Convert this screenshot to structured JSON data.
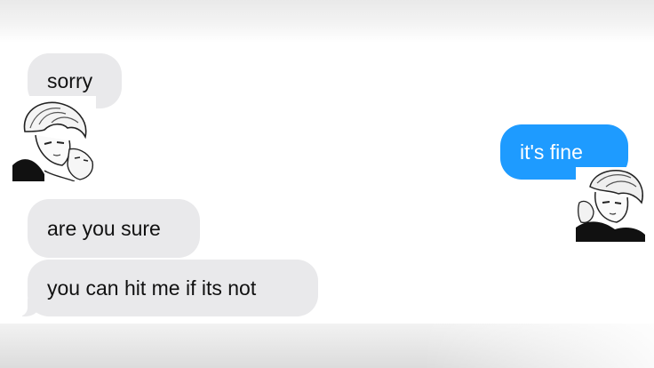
{
  "conversation": {
    "messages": [
      {
        "sender": "contact",
        "text": "sorry"
      },
      {
        "sender": "me",
        "text": "it's fine"
      },
      {
        "sender": "contact",
        "text": "are you sure"
      },
      {
        "sender": "contact",
        "text": "you can hit me if its not"
      }
    ],
    "stickers": [
      {
        "attached_to": "sorry",
        "description": "manga-sticker"
      },
      {
        "attached_to": "it's fine",
        "description": "manga-sticker"
      }
    ]
  },
  "colors": {
    "incoming_bubble": "#e9e9eb",
    "outgoing_bubble": "#1e9bff",
    "incoming_text": "#111111",
    "outgoing_text": "#ffffff"
  }
}
